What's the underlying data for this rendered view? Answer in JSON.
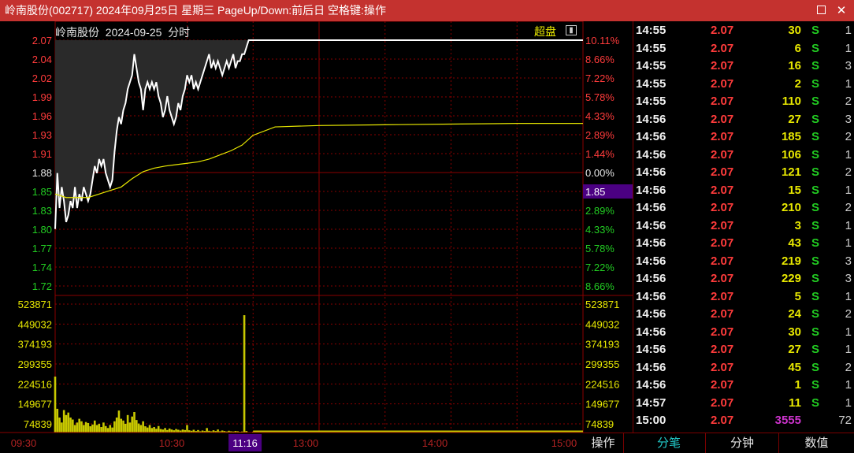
{
  "window": {
    "title": "岭南股份(002717) 2024年09月25日 星期三 PageUp/Down:前后日 空格键:操作"
  },
  "chart_header": {
    "stock": "岭南股份",
    "date": "2024-09-25",
    "period": "分时",
    "overlay_label": "超盘"
  },
  "colors": {
    "background": "#000000",
    "titlebar": "#c4322f",
    "grid_red": "#8a0000",
    "up_red": "#ff3b3b",
    "down_green": "#22cc22",
    "price_line": "#ffffff",
    "avg_line": "#e8e800",
    "volume": "#c8c800",
    "highlight_label_bg": "#4b0082"
  },
  "price_axis": {
    "left_labels": [
      "2.07",
      "2.04",
      "2.02",
      "1.99",
      "1.96",
      "1.93",
      "1.91",
      "1.88",
      "1.85",
      "1.83",
      "1.80",
      "1.77",
      "1.74",
      "1.72"
    ],
    "right_labels": [
      "10.11%",
      "8.66%",
      "7.22%",
      "5.78%",
      "4.33%",
      "2.89%",
      "1.44%",
      "0.00%",
      "",
      "2.89%",
      "4.33%",
      "5.78%",
      "7.22%",
      "8.66%"
    ],
    "current_marker": "1.85"
  },
  "volume_axis": {
    "labels": [
      "523871",
      "449032",
      "374193",
      "299355",
      "224516",
      "149677",
      "74839"
    ]
  },
  "time_axis": {
    "labels": [
      "09:30",
      "10:30",
      "13:00",
      "14:00",
      "15:00"
    ],
    "cursor_label": "11:16"
  },
  "chart_data": {
    "type": "line",
    "title": "岭南股份 2024-09-25 分时",
    "prev_close": 1.88,
    "ylim": [
      1.705,
      2.07
    ],
    "x_range_minutes": [
      0,
      240
    ],
    "series": [
      {
        "kind": "price",
        "x": [
          0,
          1,
          2,
          3,
          4,
          5,
          6,
          7,
          8,
          9,
          10,
          11,
          12,
          13,
          14,
          15,
          16,
          17,
          18,
          19,
          20,
          21,
          22,
          23,
          24,
          25,
          26,
          27,
          28,
          29,
          30,
          31,
          32,
          33,
          34,
          35,
          36,
          37,
          38,
          39,
          40,
          41,
          42,
          43,
          44,
          45,
          46,
          47,
          48,
          49,
          50,
          51,
          52,
          53,
          54,
          55,
          56,
          57,
          58,
          59,
          60,
          61,
          62,
          63,
          64,
          65,
          66,
          67,
          68,
          69,
          70,
          71,
          72,
          73,
          74,
          75,
          76,
          77,
          78,
          79,
          80,
          81,
          82,
          83,
          84,
          85,
          86,
          88,
          90,
          240
        ],
        "y": [
          1.8,
          1.88,
          1.83,
          1.86,
          1.84,
          1.81,
          1.82,
          1.84,
          1.83,
          1.86,
          1.83,
          1.85,
          1.84,
          1.86,
          1.85,
          1.84,
          1.85,
          1.87,
          1.89,
          1.88,
          1.9,
          1.89,
          1.9,
          1.88,
          1.87,
          1.86,
          1.87,
          1.91,
          1.94,
          1.96,
          1.95,
          1.97,
          1.98,
          2.0,
          2.01,
          2.02,
          2.05,
          2.03,
          2.01,
          2.0,
          1.97,
          2.0,
          2.01,
          2.0,
          2.01,
          2.0,
          2.01,
          1.99,
          1.98,
          1.96,
          1.97,
          1.99,
          1.97,
          1.96,
          1.95,
          1.96,
          1.98,
          1.97,
          1.99,
          2.0,
          2.02,
          2.01,
          2.02,
          2.0,
          2.01,
          2.0,
          2.01,
          2.02,
          2.03,
          2.04,
          2.05,
          2.03,
          2.04,
          2.03,
          2.04,
          2.03,
          2.02,
          2.03,
          2.04,
          2.03,
          2.04,
          2.05,
          2.03,
          2.04,
          2.04,
          2.05,
          2.05,
          2.07,
          2.07,
          2.07
        ]
      },
      {
        "kind": "average",
        "x": [
          0,
          5,
          10,
          15,
          20,
          25,
          30,
          35,
          40,
          45,
          50,
          55,
          60,
          65,
          70,
          75,
          80,
          85,
          90,
          100,
          120,
          150,
          180,
          210,
          240
        ],
        "y": [
          1.85,
          1.845,
          1.845,
          1.845,
          1.85,
          1.855,
          1.86,
          1.872,
          1.882,
          1.887,
          1.89,
          1.892,
          1.894,
          1.896,
          1.9,
          1.906,
          1.912,
          1.92,
          1.934,
          1.946,
          1.948,
          1.949,
          1.95,
          1.951,
          1.951
        ]
      }
    ],
    "volume": {
      "ylim": [
        0,
        523871
      ],
      "bars": [
        {
          "x": 0,
          "v": 224000
        },
        {
          "x": 1,
          "v": 95000
        },
        {
          "x": 2,
          "v": 60000
        },
        {
          "x": 3,
          "v": 40000
        },
        {
          "x": 4,
          "v": 90000
        },
        {
          "x": 5,
          "v": 70000
        },
        {
          "x": 6,
          "v": 80000
        },
        {
          "x": 7,
          "v": 60000
        },
        {
          "x": 8,
          "v": 52000
        },
        {
          "x": 9,
          "v": 30000
        },
        {
          "x": 10,
          "v": 40000
        },
        {
          "x": 11,
          "v": 55000
        },
        {
          "x": 12,
          "v": 45000
        },
        {
          "x": 13,
          "v": 30000
        },
        {
          "x": 14,
          "v": 42000
        },
        {
          "x": 15,
          "v": 38000
        },
        {
          "x": 16,
          "v": 25000
        },
        {
          "x": 17,
          "v": 32000
        },
        {
          "x": 18,
          "v": 48000
        },
        {
          "x": 19,
          "v": 30000
        },
        {
          "x": 20,
          "v": 35000
        },
        {
          "x": 21,
          "v": 22000
        },
        {
          "x": 22,
          "v": 40000
        },
        {
          "x": 23,
          "v": 26000
        },
        {
          "x": 24,
          "v": 18000
        },
        {
          "x": 25,
          "v": 30000
        },
        {
          "x": 26,
          "v": 20000
        },
        {
          "x": 27,
          "v": 45000
        },
        {
          "x": 28,
          "v": 60000
        },
        {
          "x": 29,
          "v": 88000
        },
        {
          "x": 30,
          "v": 55000
        },
        {
          "x": 31,
          "v": 48000
        },
        {
          "x": 32,
          "v": 35000
        },
        {
          "x": 33,
          "v": 70000
        },
        {
          "x": 34,
          "v": 40000
        },
        {
          "x": 35,
          "v": 64000
        },
        {
          "x": 36,
          "v": 82000
        },
        {
          "x": 37,
          "v": 50000
        },
        {
          "x": 38,
          "v": 36000
        },
        {
          "x": 39,
          "v": 30000
        },
        {
          "x": 40,
          "v": 45000
        },
        {
          "x": 41,
          "v": 25000
        },
        {
          "x": 42,
          "v": 20000
        },
        {
          "x": 43,
          "v": 30000
        },
        {
          "x": 44,
          "v": 18000
        },
        {
          "x": 45,
          "v": 22000
        },
        {
          "x": 46,
          "v": 15000
        },
        {
          "x": 47,
          "v": 26000
        },
        {
          "x": 48,
          "v": 14000
        },
        {
          "x": 49,
          "v": 12000
        },
        {
          "x": 50,
          "v": 18000
        },
        {
          "x": 51,
          "v": 10000
        },
        {
          "x": 52,
          "v": 16000
        },
        {
          "x": 53,
          "v": 12000
        },
        {
          "x": 54,
          "v": 9000
        },
        {
          "x": 55,
          "v": 14000
        },
        {
          "x": 56,
          "v": 11000
        },
        {
          "x": 57,
          "v": 8000
        },
        {
          "x": 58,
          "v": 12000
        },
        {
          "x": 59,
          "v": 10000
        },
        {
          "x": 60,
          "v": 30000
        },
        {
          "x": 61,
          "v": 9000
        },
        {
          "x": 62,
          "v": 7000
        },
        {
          "x": 63,
          "v": 11000
        },
        {
          "x": 64,
          "v": 6000
        },
        {
          "x": 65,
          "v": 10000
        },
        {
          "x": 66,
          "v": 5000
        },
        {
          "x": 67,
          "v": 8000
        },
        {
          "x": 68,
          "v": 6000
        },
        {
          "x": 69,
          "v": 18000
        },
        {
          "x": 70,
          "v": 7000
        },
        {
          "x": 71,
          "v": 5000
        },
        {
          "x": 72,
          "v": 9000
        },
        {
          "x": 73,
          "v": 6000
        },
        {
          "x": 74,
          "v": 12000
        },
        {
          "x": 75,
          "v": 5000
        },
        {
          "x": 76,
          "v": 8000
        },
        {
          "x": 77,
          "v": 6000
        },
        {
          "x": 78,
          "v": 4000
        },
        {
          "x": 79,
          "v": 7000
        },
        {
          "x": 80,
          "v": 5000
        },
        {
          "x": 81,
          "v": 4000
        },
        {
          "x": 82,
          "v": 6000
        },
        {
          "x": 83,
          "v": 5000
        },
        {
          "x": 84,
          "v": 3000
        },
        {
          "x": 85,
          "v": 4000
        },
        {
          "x": 86,
          "v": 470000
        },
        {
          "x": 87,
          "v": 6000
        },
        {
          "x": 90,
          "v": 3000
        },
        {
          "x": 100,
          "v": 3000
        },
        {
          "x": 110,
          "v": 2000
        },
        {
          "x": 120,
          "v": 2500
        },
        {
          "x": 130,
          "v": 2000
        },
        {
          "x": 140,
          "v": 1500
        },
        {
          "x": 150,
          "v": 2000
        },
        {
          "x": 160,
          "v": 1500
        },
        {
          "x": 170,
          "v": 1500
        },
        {
          "x": 180,
          "v": 1500
        },
        {
          "x": 190,
          "v": 1200
        },
        {
          "x": 200,
          "v": 1200
        },
        {
          "x": 210,
          "v": 1200
        },
        {
          "x": 220,
          "v": 1000
        },
        {
          "x": 230,
          "v": 1000
        },
        {
          "x": 239,
          "v": 3555
        }
      ]
    }
  },
  "ticks": {
    "rows": [
      {
        "time": "14:55",
        "price": "2.07",
        "vol": "30",
        "bs": "S",
        "cnt": "1"
      },
      {
        "time": "14:55",
        "price": "2.07",
        "vol": "6",
        "bs": "S",
        "cnt": "1"
      },
      {
        "time": "14:55",
        "price": "2.07",
        "vol": "16",
        "bs": "S",
        "cnt": "3"
      },
      {
        "time": "14:55",
        "price": "2.07",
        "vol": "2",
        "bs": "S",
        "cnt": "1"
      },
      {
        "time": "14:55",
        "price": "2.07",
        "vol": "110",
        "bs": "S",
        "cnt": "2"
      },
      {
        "time": "14:56",
        "price": "2.07",
        "vol": "27",
        "bs": "S",
        "cnt": "3"
      },
      {
        "time": "14:56",
        "price": "2.07",
        "vol": "185",
        "bs": "S",
        "cnt": "2"
      },
      {
        "time": "14:56",
        "price": "2.07",
        "vol": "106",
        "bs": "S",
        "cnt": "1"
      },
      {
        "time": "14:56",
        "price": "2.07",
        "vol": "121",
        "bs": "S",
        "cnt": "2"
      },
      {
        "time": "14:56",
        "price": "2.07",
        "vol": "15",
        "bs": "S",
        "cnt": "1"
      },
      {
        "time": "14:56",
        "price": "2.07",
        "vol": "210",
        "bs": "S",
        "cnt": "2"
      },
      {
        "time": "14:56",
        "price": "2.07",
        "vol": "3",
        "bs": "S",
        "cnt": "1"
      },
      {
        "time": "14:56",
        "price": "2.07",
        "vol": "43",
        "bs": "S",
        "cnt": "1"
      },
      {
        "time": "14:56",
        "price": "2.07",
        "vol": "219",
        "bs": "S",
        "cnt": "3"
      },
      {
        "time": "14:56",
        "price": "2.07",
        "vol": "229",
        "bs": "S",
        "cnt": "3"
      },
      {
        "time": "14:56",
        "price": "2.07",
        "vol": "5",
        "bs": "S",
        "cnt": "1"
      },
      {
        "time": "14:56",
        "price": "2.07",
        "vol": "24",
        "bs": "S",
        "cnt": "2"
      },
      {
        "time": "14:56",
        "price": "2.07",
        "vol": "30",
        "bs": "S",
        "cnt": "1"
      },
      {
        "time": "14:56",
        "price": "2.07",
        "vol": "27",
        "bs": "S",
        "cnt": "1"
      },
      {
        "time": "14:56",
        "price": "2.07",
        "vol": "45",
        "bs": "S",
        "cnt": "2"
      },
      {
        "time": "14:56",
        "price": "2.07",
        "vol": "1",
        "bs": "S",
        "cnt": "1"
      },
      {
        "time": "14:57",
        "price": "2.07",
        "vol": "11",
        "bs": "S",
        "cnt": "1"
      },
      {
        "time": "15:00",
        "price": "2.07",
        "vol": "3555",
        "bs": "",
        "cnt": "72"
      }
    ]
  },
  "tabs": {
    "operate": "操作",
    "ticks": "分笔",
    "minutes": "分钟",
    "values": "数值"
  }
}
